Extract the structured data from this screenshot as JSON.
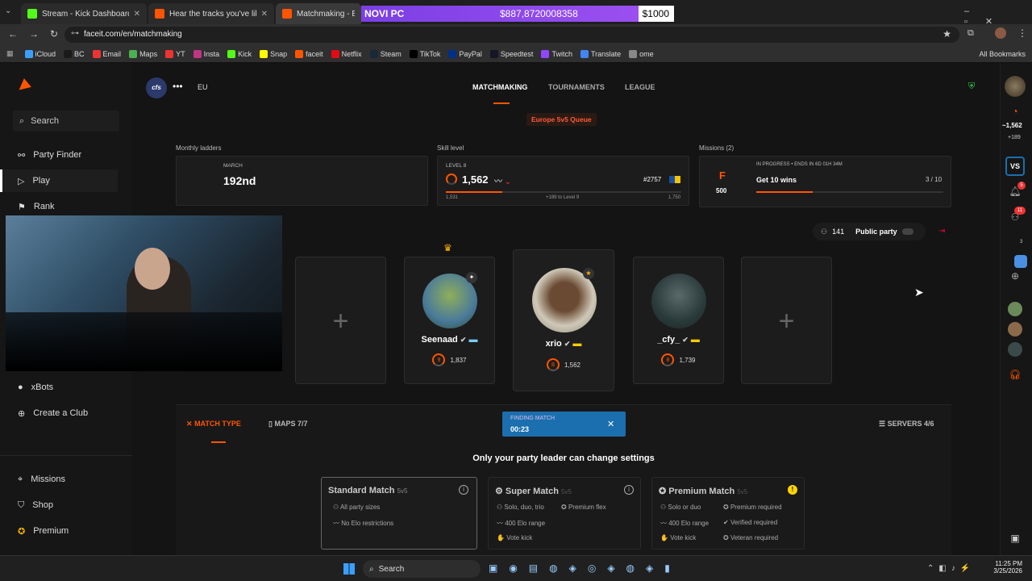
{
  "browser": {
    "tabs": [
      {
        "title": "Stream - Kick Dashboard",
        "color": "#53fc18"
      },
      {
        "title": "Hear the tracks you've liked: on",
        "color": "#ff5500"
      },
      {
        "title": "Matchmaking - Europe",
        "color": "#ff5500"
      }
    ],
    "url": "faceit.com/en/matchmaking",
    "bookmarks": [
      "iCloud",
      "BC",
      "Email",
      "Maps",
      "YT",
      "Insta",
      "Kick",
      "Snap",
      "faceit",
      "Netflix",
      "Steam",
      "TikTok",
      "PayPal",
      "Speedtest",
      "Twitch",
      "Translate",
      "ome"
    ],
    "all_bookmarks": "All Bookmarks"
  },
  "overlay": {
    "label": "NOVI PC",
    "current": "$887,8720008358",
    "goal": "$1000",
    "progress": 0.887
  },
  "sidebar": {
    "search": "Search",
    "items": [
      "Party Finder",
      "Play",
      "Rank"
    ],
    "lower": [
      "xBots",
      "Create a Club"
    ],
    "bottom": [
      "Missions",
      "Shop",
      "Premium"
    ]
  },
  "header": {
    "region": "EU",
    "club": "cfs",
    "nav": [
      "MATCHMAKING",
      "TOURNAMENTS",
      "LEAGUE"
    ]
  },
  "queue": "Europe 5v5 Queue",
  "ladder": {
    "label": "Monthly ladders",
    "month": "MARCH",
    "rank": "192nd"
  },
  "skill": {
    "label": "Skill level",
    "level": "LEVEL 8",
    "elo": "1,562",
    "rank": "#2757",
    "low": "1,531",
    "mid": "+189 to Level 9",
    "high": "1,750",
    "progress": 0.24
  },
  "missions": {
    "label": "Missions (2)",
    "status": "IN PROGRESS • ENDS IN 6D 01H 34M",
    "title": "Get 10 wins",
    "count": "3 / 10",
    "points": "500",
    "progress": 0.3
  },
  "party": {
    "count": "141",
    "public_label": "Public party",
    "partial": "d"
  },
  "players": [
    {
      "name": "Seenaad",
      "elo": "1,837",
      "lvl": "9"
    },
    {
      "name": "xrio",
      "elo": "1,562",
      "lvl": "8"
    },
    {
      "name": "_cfy_",
      "elo": "1,739",
      "lvl": "8"
    }
  ],
  "tabs": {
    "match_type": "MATCH TYPE",
    "maps": "MAPS 7/7",
    "servers": "SERVERS 4/6"
  },
  "finding": {
    "label": "FINDING MATCH",
    "time": "00:23"
  },
  "leader_note": "Only your party leader can change settings",
  "modes": [
    {
      "title": "Standard Match",
      "sub": "5v5",
      "f": [
        "All party sizes",
        "No Elo restrictions"
      ]
    },
    {
      "title": "Super Match",
      "sub": "5v5",
      "f": [
        "Solo, duo, trio",
        "Premium flex",
        "400 Elo range",
        "Vote kick"
      ]
    },
    {
      "title": "Premium Match",
      "sub": "5v5",
      "f": [
        "Solo or duo",
        "Premium required",
        "400 Elo range",
        "Verified required",
        "Vote kick",
        "Veteran required"
      ]
    }
  ],
  "rail": {
    "elo": "~1,562",
    "diff": "+189",
    "notif": "5",
    "friends": "11",
    "three": "3"
  },
  "taskbar": {
    "search": "Search",
    "time": "11:25 PM",
    "date": "3/25/2026"
  }
}
